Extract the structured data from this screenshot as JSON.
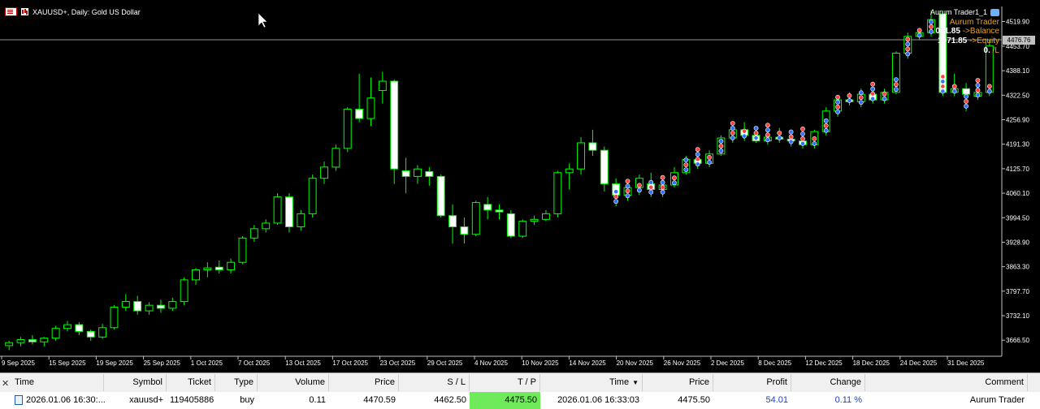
{
  "chart": {
    "symbol_title": "XAUUSD+, Daily:  Gold US Dollar",
    "bid_badge": "4476.76",
    "y_ticks": [
      "4519.90",
      "4453.70",
      "4388.10",
      "4322.50",
      "4256.90",
      "4191.30",
      "4125.70",
      "4060.10",
      "3994.50",
      "3928.90",
      "3863.30",
      "3797.70",
      "3732.10",
      "3666.50"
    ],
    "x_ticks": [
      "9 Sep 2025",
      "15 Sep 2025",
      "19 Sep 2025",
      "25 Sep 2025",
      "1 Oct 2025",
      "7 Oct 2025",
      "13 Oct 2025",
      "17 Oct 2025",
      "23 Oct 2025",
      "29 Oct 2025",
      "4 Nov 2025",
      "10 Nov 2025",
      "14 Nov 2025",
      "20 Nov 2025",
      "26 Nov 2025",
      "2 Dec 2025",
      "8 Dec 2025",
      "12 Dec 2025",
      "18 Dec 2025",
      "24 Dec 2025",
      "31 Dec 2025"
    ],
    "colors": {
      "bg": "#000000",
      "up": "#00ff00",
      "down_fill": "#ffffff",
      "wick": "#00ff00",
      "grid_text": "#ffffff",
      "marker_red": "#ff4040",
      "marker_blue": "#3070ff"
    }
  },
  "ea": {
    "name": "Aurum Trader1_1",
    "icon": "graduation-cap-icon",
    "title": "Aurum Trader",
    "balance_value": "071.85",
    "balance_label": "->Balance",
    "equity_value": "1071.85",
    "equity_label": "->Equity",
    "pl_value": "0.",
    "pl_label": "/L"
  },
  "trades": {
    "headers": {
      "time": "Time",
      "symbol": "Symbol",
      "ticket": "Ticket",
      "type": "Type",
      "volume": "Volume",
      "price": "Price",
      "sl": "S / L",
      "tp": "T / P",
      "time2": "Time",
      "price2": "Price",
      "profit": "Profit",
      "change": "Change",
      "comment": "Comment"
    },
    "row": {
      "time": "2026.01.06 16:30:...",
      "symbol": "xauusd+",
      "ticket": "119405886",
      "type": "buy",
      "volume": "0.11",
      "price": "4470.59",
      "sl": "4462.50",
      "tp": "4475.50",
      "time2": "2026.01.06 16:33:03",
      "price2": "4475.50",
      "profit": "54.01",
      "change": "0.11 %",
      "comment": "Aurum Trader"
    }
  },
  "chart_data": {
    "type": "candlestick",
    "title": "XAUUSD+, Daily:  Gold US Dollar",
    "y_range": [
      3630,
      4560
    ],
    "candles": [
      {
        "o": 3652,
        "h": 3665,
        "l": 3640,
        "c": 3660
      },
      {
        "o": 3660,
        "h": 3675,
        "l": 3650,
        "c": 3668
      },
      {
        "o": 3668,
        "h": 3680,
        "l": 3655,
        "c": 3662
      },
      {
        "o": 3662,
        "h": 3675,
        "l": 3650,
        "c": 3672
      },
      {
        "o": 3672,
        "h": 3705,
        "l": 3665,
        "c": 3698
      },
      {
        "o": 3698,
        "h": 3718,
        "l": 3690,
        "c": 3708
      },
      {
        "o": 3708,
        "h": 3715,
        "l": 3680,
        "c": 3690
      },
      {
        "o": 3690,
        "h": 3695,
        "l": 3665,
        "c": 3675
      },
      {
        "o": 3675,
        "h": 3710,
        "l": 3670,
        "c": 3700
      },
      {
        "o": 3700,
        "h": 3760,
        "l": 3695,
        "c": 3755
      },
      {
        "o": 3755,
        "h": 3790,
        "l": 3745,
        "c": 3770
      },
      {
        "o": 3770,
        "h": 3785,
        "l": 3735,
        "c": 3745
      },
      {
        "o": 3745,
        "h": 3768,
        "l": 3735,
        "c": 3760
      },
      {
        "o": 3760,
        "h": 3775,
        "l": 3740,
        "c": 3752
      },
      {
        "o": 3752,
        "h": 3780,
        "l": 3745,
        "c": 3770
      },
      {
        "o": 3770,
        "h": 3835,
        "l": 3760,
        "c": 3828
      },
      {
        "o": 3828,
        "h": 3860,
        "l": 3815,
        "c": 3855
      },
      {
        "o": 3855,
        "h": 3875,
        "l": 3835,
        "c": 3860
      },
      {
        "o": 3862,
        "h": 3880,
        "l": 3845,
        "c": 3855
      },
      {
        "o": 3855,
        "h": 3885,
        "l": 3845,
        "c": 3875
      },
      {
        "o": 3875,
        "h": 3945,
        "l": 3870,
        "c": 3940
      },
      {
        "o": 3940,
        "h": 3975,
        "l": 3930,
        "c": 3965
      },
      {
        "o": 3965,
        "h": 3990,
        "l": 3955,
        "c": 3980
      },
      {
        "o": 3980,
        "h": 4060,
        "l": 3975,
        "c": 4050
      },
      {
        "o": 4050,
        "h": 4060,
        "l": 3955,
        "c": 3970
      },
      {
        "o": 3970,
        "h": 4015,
        "l": 3960,
        "c": 4005
      },
      {
        "o": 4005,
        "h": 4110,
        "l": 3995,
        "c": 4100
      },
      {
        "o": 4100,
        "h": 4145,
        "l": 4085,
        "c": 4130
      },
      {
        "o": 4130,
        "h": 4190,
        "l": 4120,
        "c": 4180
      },
      {
        "o": 4180,
        "h": 4290,
        "l": 4170,
        "c": 4285
      },
      {
        "o": 4285,
        "h": 4380,
        "l": 4250,
        "c": 4260
      },
      {
        "o": 4260,
        "h": 4370,
        "l": 4240,
        "c": 4315
      },
      {
        "o": 4335,
        "h": 4385,
        "l": 4300,
        "c": 4360
      },
      {
        "o": 4360,
        "h": 4365,
        "l": 4085,
        "c": 4125
      },
      {
        "o": 4120,
        "h": 4155,
        "l": 4060,
        "c": 4105
      },
      {
        "o": 4105,
        "h": 4135,
        "l": 4085,
        "c": 4125
      },
      {
        "o": 4118,
        "h": 4130,
        "l": 4080,
        "c": 4105
      },
      {
        "o": 4105,
        "h": 4110,
        "l": 3995,
        "c": 4000
      },
      {
        "o": 4000,
        "h": 4030,
        "l": 3925,
        "c": 3970
      },
      {
        "o": 3970,
        "h": 3995,
        "l": 3925,
        "c": 3950
      },
      {
        "o": 3950,
        "h": 4040,
        "l": 3945,
        "c": 4035
      },
      {
        "o": 4030,
        "h": 4050,
        "l": 3990,
        "c": 4015
      },
      {
        "o": 4015,
        "h": 4030,
        "l": 3990,
        "c": 4010
      },
      {
        "o": 4005,
        "h": 4015,
        "l": 3940,
        "c": 3945
      },
      {
        "o": 3945,
        "h": 3990,
        "l": 3940,
        "c": 3985
      },
      {
        "o": 3985,
        "h": 4000,
        "l": 3975,
        "c": 3990
      },
      {
        "o": 3990,
        "h": 4015,
        "l": 3985,
        "c": 4005
      },
      {
        "o": 4005,
        "h": 4120,
        "l": 3995,
        "c": 4115
      },
      {
        "o": 4115,
        "h": 4140,
        "l": 4070,
        "c": 4125
      },
      {
        "o": 4125,
        "h": 4210,
        "l": 4110,
        "c": 4195
      },
      {
        "o": 4195,
        "h": 4230,
        "l": 4160,
        "c": 4175
      },
      {
        "o": 4175,
        "h": 4185,
        "l": 4065,
        "c": 4085
      },
      {
        "o": 4085,
        "h": 4100,
        "l": 4025,
        "c": 4055
      },
      {
        "o": 4055,
        "h": 4090,
        "l": 4040,
        "c": 4075
      },
      {
        "o": 4075,
        "h": 4110,
        "l": 4055,
        "c": 4100
      },
      {
        "o": 4085,
        "h": 4115,
        "l": 4050,
        "c": 4070
      },
      {
        "o": 4070,
        "h": 4100,
        "l": 4050,
        "c": 4082
      },
      {
        "o": 4082,
        "h": 4130,
        "l": 4075,
        "c": 4115
      },
      {
        "o": 4115,
        "h": 4160,
        "l": 4110,
        "c": 4150
      },
      {
        "o": 4150,
        "h": 4175,
        "l": 4125,
        "c": 4140
      },
      {
        "o": 4140,
        "h": 4175,
        "l": 4130,
        "c": 4165
      },
      {
        "o": 4165,
        "h": 4215,
        "l": 4160,
        "c": 4208
      },
      {
        "o": 4208,
        "h": 4240,
        "l": 4195,
        "c": 4230
      },
      {
        "o": 4230,
        "h": 4250,
        "l": 4200,
        "c": 4215
      },
      {
        "o": 4215,
        "h": 4230,
        "l": 4195,
        "c": 4200
      },
      {
        "o": 4200,
        "h": 4225,
        "l": 4190,
        "c": 4210
      },
      {
        "o": 4210,
        "h": 4235,
        "l": 4195,
        "c": 4205
      },
      {
        "o": 4205,
        "h": 4220,
        "l": 4185,
        "c": 4200
      },
      {
        "o": 4200,
        "h": 4215,
        "l": 4180,
        "c": 4190
      },
      {
        "o": 4190,
        "h": 4230,
        "l": 4180,
        "c": 4225
      },
      {
        "o": 4225,
        "h": 4290,
        "l": 4215,
        "c": 4280
      },
      {
        "o": 4280,
        "h": 4320,
        "l": 4265,
        "c": 4310
      },
      {
        "o": 4310,
        "h": 4330,
        "l": 4295,
        "c": 4305
      },
      {
        "o": 4305,
        "h": 4340,
        "l": 4290,
        "c": 4325
      },
      {
        "o": 4325,
        "h": 4340,
        "l": 4300,
        "c": 4310
      },
      {
        "o": 4310,
        "h": 4340,
        "l": 4300,
        "c": 4330
      },
      {
        "o": 4330,
        "h": 4440,
        "l": 4325,
        "c": 4435
      },
      {
        "o": 4435,
        "h": 4490,
        "l": 4420,
        "c": 4480
      },
      {
        "o": 4480,
        "h": 4495,
        "l": 4470,
        "c": 4490
      },
      {
        "o": 4490,
        "h": 4550,
        "l": 4480,
        "c": 4525
      },
      {
        "o": 4540,
        "h": 4548,
        "l": 4320,
        "c": 4330
      },
      {
        "o": 4330,
        "h": 4380,
        "l": 4320,
        "c": 4340
      },
      {
        "o": 4340,
        "h": 4355,
        "l": 4280,
        "c": 4325
      },
      {
        "o": 4320,
        "h": 4350,
        "l": 4310,
        "c": 4330
      },
      {
        "o": 4330,
        "h": 4470,
        "l": 4320,
        "c": 4455
      }
    ]
  }
}
